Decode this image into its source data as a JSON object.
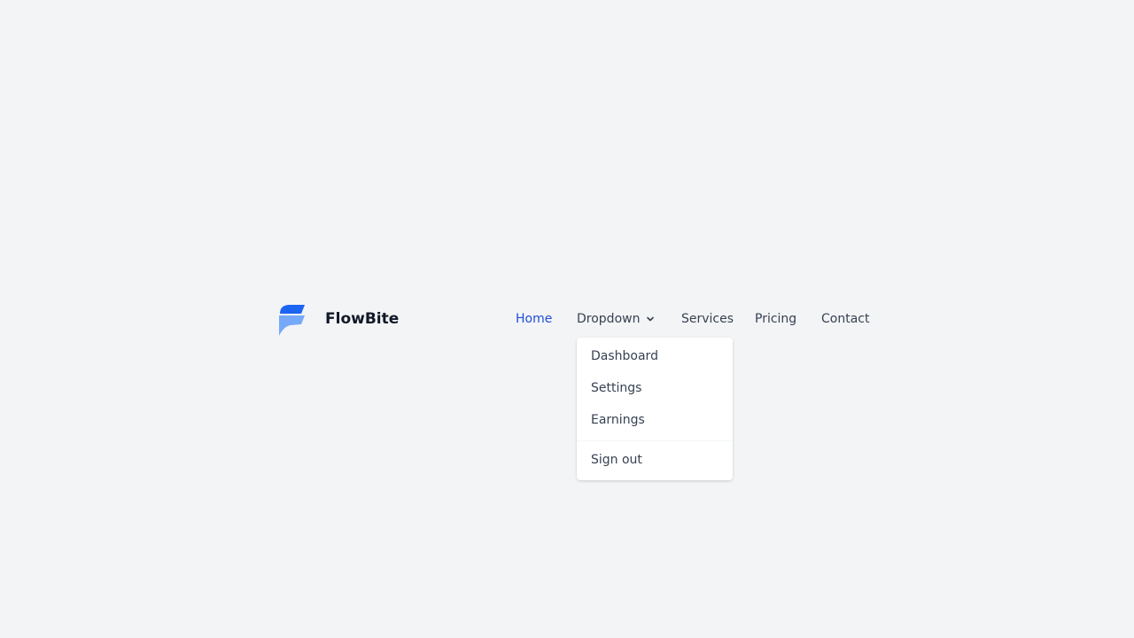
{
  "brand": {
    "name": "FlowBite",
    "logo_icon": "flowbite-logo-icon"
  },
  "nav": {
    "items": [
      {
        "label": "Home",
        "active": true
      },
      {
        "label": "Dropdown",
        "icon": "chevron-down-icon",
        "expanded": true
      },
      {
        "label": "Services"
      },
      {
        "label": "Pricing"
      },
      {
        "label": "Contact"
      }
    ]
  },
  "dropdown": {
    "items": [
      {
        "label": "Dashboard"
      },
      {
        "label": "Settings"
      },
      {
        "label": "Earnings"
      }
    ],
    "footer_item": {
      "label": "Sign out"
    }
  },
  "colors": {
    "page_background": "#f3f4f6",
    "accent": "#1d4ed8",
    "logo_dark": "#1c64f2",
    "logo_light": "#76a9fa",
    "text": "#374151",
    "brand_text": "#111827"
  }
}
